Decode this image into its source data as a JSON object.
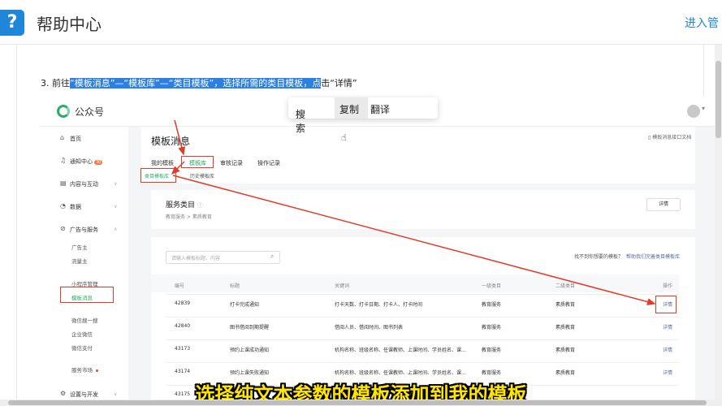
{
  "header": {
    "logo_glyph": "?",
    "title": "帮助中心",
    "enter_admin": "进入管"
  },
  "article": {
    "step_prefix": "3. 前往",
    "step_highlight": "“模板消息”—“模板库”—“类目模板”，选择所需的类目模板，点",
    "step_suffix": "击“详情”"
  },
  "popup": {
    "search": "搜索",
    "copy": "复制",
    "translate": "翻译"
  },
  "mp": {
    "name": "公众号",
    "sidebar": {
      "home": "首页",
      "notify": "通知中心",
      "notify_badge": "30",
      "content": "内容与互动",
      "data": "数据",
      "ads": "广告与服务",
      "sub_ads": "广告主",
      "sub_traffic": "流量主",
      "sub_mini": "小程序管理",
      "sub_template": "模板消息",
      "sub_search": "微信搜一搜",
      "sub_work": "企业微信",
      "sub_pay": "微信支付",
      "market": "服务市场",
      "settings": "设置与开发"
    },
    "page_title": "模板消息",
    "doc_link": "模板消息接口文档",
    "tabs": [
      "我的模板",
      "模板库",
      "审核记录",
      "操作记录"
    ],
    "sub_tabs": [
      "类目模板库",
      "历史模板库"
    ],
    "service": {
      "title": "服务类目",
      "path": "教育服务 > 素质教育",
      "detail": "详情"
    },
    "search_placeholder": "请输入模板标题、内容",
    "not_found": "找不到你想要的模板？",
    "not_found_link": "帮助我们完善类目模板库",
    "table": {
      "headers": [
        "编号",
        "标题",
        "关键词",
        "一级类目",
        "二级类目",
        "操作"
      ],
      "rows": [
        [
          "42839",
          "打卡完成通知",
          "打卡天数、打卡日期、打卡人、打卡时间",
          "教育服务",
          "素质教育",
          "详情"
        ],
        [
          "42840",
          "图书借阅到期提醒",
          "借阅人员、借阅时间、图书列表",
          "教育服务",
          "素质教育",
          "详情"
        ],
        [
          "43173",
          "预约上课成功通知",
          "机构名称、班级名称、任课教师、上课时间、学员姓名、课...",
          "教育服务",
          "素质教育",
          "详情"
        ],
        [
          "43174",
          "预约上课失败通知",
          "机构名称、班级名称、任课教师、上课时间、学员姓名、课...",
          "教育服务",
          "素质教育",
          "详情"
        ],
        [
          "43175",
          "",
          "",
          "",
          "",
          ""
        ]
      ]
    }
  },
  "caption": "选择纯文本参数的模板添加到我的模板",
  "colors": {
    "accent": "#1f86d8",
    "highlight": "#2c7fe3",
    "annotation_red": "#e23b2a",
    "mp_green": "#2aae67",
    "caption_yellow": "#ffe600"
  }
}
